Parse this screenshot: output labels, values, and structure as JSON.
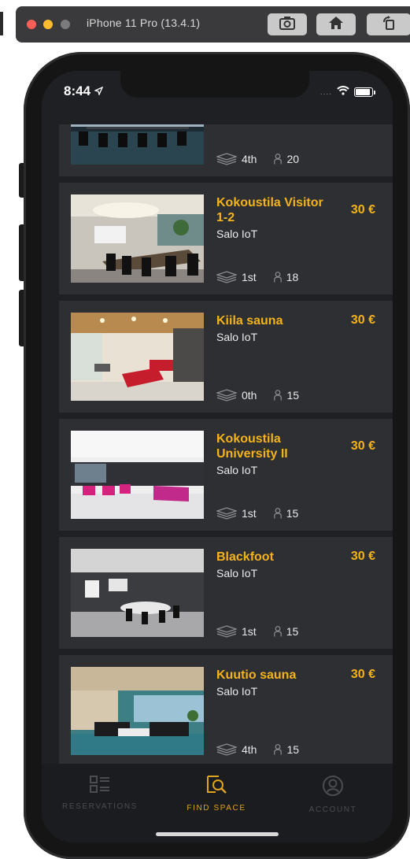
{
  "simulator": {
    "title": "iPhone 11 Pro (13.4.1)",
    "buttons": [
      "screenshot-icon",
      "home-icon",
      "rotate-icon"
    ]
  },
  "status": {
    "time": "8:44",
    "signal": "....",
    "icons": [
      "location-arrow-icon",
      "wifi-icon",
      "battery-icon"
    ]
  },
  "colors": {
    "accent": "#f5b31b",
    "card": "#2d2f33",
    "background": "#1f2023"
  },
  "spaces": [
    {
      "name": "",
      "price": "",
      "location": "",
      "floor": "4th",
      "capacity": "20"
    },
    {
      "name": "Kokoustila Visitor 1-2",
      "price": "30 €",
      "location": "Salo IoT",
      "floor": "1st",
      "capacity": "18"
    },
    {
      "name": "Kiila sauna",
      "price": "30 €",
      "location": "Salo IoT",
      "floor": "0th",
      "capacity": "15"
    },
    {
      "name": "Kokoustila University II",
      "price": "30 €",
      "location": "Salo IoT",
      "floor": "1st",
      "capacity": "15"
    },
    {
      "name": "Blackfoot",
      "price": "30 €",
      "location": "Salo IoT",
      "floor": "1st",
      "capacity": "15"
    },
    {
      "name": "Kuutio sauna",
      "price": "30 €",
      "location": "Salo IoT",
      "floor": "4th",
      "capacity": "15"
    }
  ],
  "tabs": [
    {
      "label": "RESERVATIONS",
      "icon": "list-icon",
      "active": false
    },
    {
      "label": "FIND SPACE",
      "icon": "search-space-icon",
      "active": true
    },
    {
      "label": "ACCOUNT",
      "icon": "account-icon",
      "active": false
    }
  ]
}
